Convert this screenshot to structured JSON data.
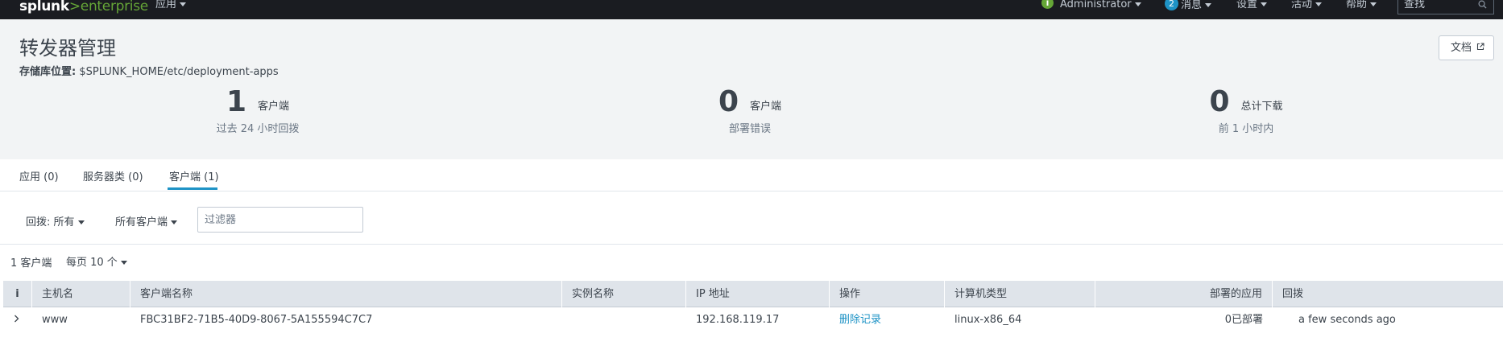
{
  "app": {
    "logo_main": "splunk",
    "logo_gt": ">",
    "logo_sub": "enterprise",
    "apps_menu": "应用"
  },
  "topnav": {
    "user": "Administrator",
    "messages_count": "2",
    "messages": "消息",
    "settings": "设置",
    "activity": "活动",
    "help": "帮助",
    "search_placeholder": "查找"
  },
  "header": {
    "title": "转发器管理",
    "repo_label": "存储库位置:",
    "repo_path": " $SPLUNK_HOME/etc/deployment-apps",
    "docs_button": "文档"
  },
  "stats": [
    {
      "value": "1",
      "unit": "客户端",
      "sub": "过去 24 小时回拨"
    },
    {
      "value": "0",
      "unit": "客户端",
      "sub": "部署错误"
    },
    {
      "value": "0",
      "unit": "总计下载",
      "sub": "前 1 小时内"
    }
  ],
  "tabs": [
    {
      "label": "应用 (0)",
      "active": false
    },
    {
      "label": "服务器类 (0)",
      "active": false
    },
    {
      "label": "客户端 (1)",
      "active": true
    }
  ],
  "filters": {
    "phonehome": "回拨: 所有",
    "clients": "所有客户端",
    "filter_placeholder": "过滤器"
  },
  "list": {
    "count_text": "1 客户端",
    "per_page": "每页 10 个"
  },
  "table": {
    "columns": [
      "i",
      "主机名",
      "客户端名称",
      "实例名称",
      "IP 地址",
      "操作",
      "计算机类型",
      "部署的应用",
      "回拨"
    ],
    "rows": [
      {
        "hostname": "www",
        "client_name": "FBC31BF2-71B5-40D9-8067-5A155594C7C7",
        "instance_name": "",
        "ip": "192.168.119.17",
        "action": "删除记录",
        "machine_type": "linux-x86_64",
        "deployed_apps": "0已部署",
        "phonehome": "a few seconds ago"
      }
    ]
  },
  "colors": {
    "topbar_bg": "#1a1c21",
    "brand_green": "#65a637",
    "accent_blue": "#1e93c6",
    "header_bg": "#f2f4f5",
    "table_header_bg": "#dfe4ea"
  }
}
